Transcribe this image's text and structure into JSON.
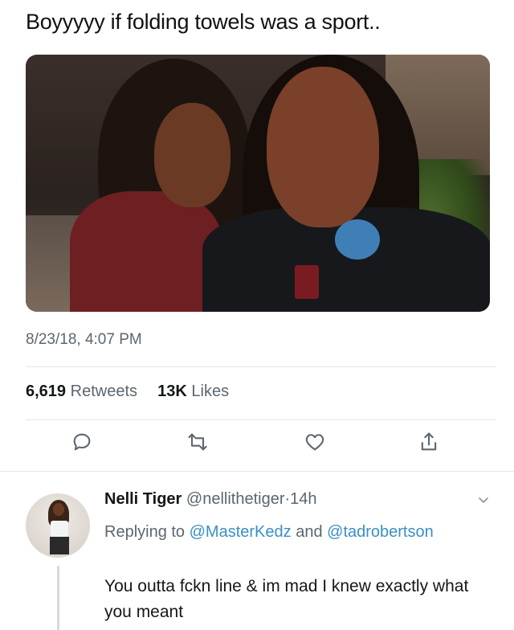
{
  "tweet": {
    "text": "Boyyyyy if folding towels was a sport..",
    "timestamp": "8/23/18, 4:07 PM",
    "retweets_count": "6,619",
    "retweets_label": "Retweets",
    "likes_count": "13K",
    "likes_label": "Likes"
  },
  "actions": [
    {
      "icon": "reply-icon"
    },
    {
      "icon": "retweet-icon"
    },
    {
      "icon": "like-icon"
    },
    {
      "icon": "share-icon"
    }
  ],
  "reply": {
    "name": "Nelli Tiger",
    "handle": "@nellithetiger",
    "separator": "·",
    "time": "14h",
    "replying_prefix": "Replying to",
    "mention_1": "@MasterKedz",
    "and_word": "and",
    "mention_2": "@tadrobertson",
    "text": "You outta fckn line & im mad I knew exactly what you meant"
  },
  "colors": {
    "link": "#3b8fc4",
    "muted": "#5b6670",
    "text": "#14171a"
  }
}
